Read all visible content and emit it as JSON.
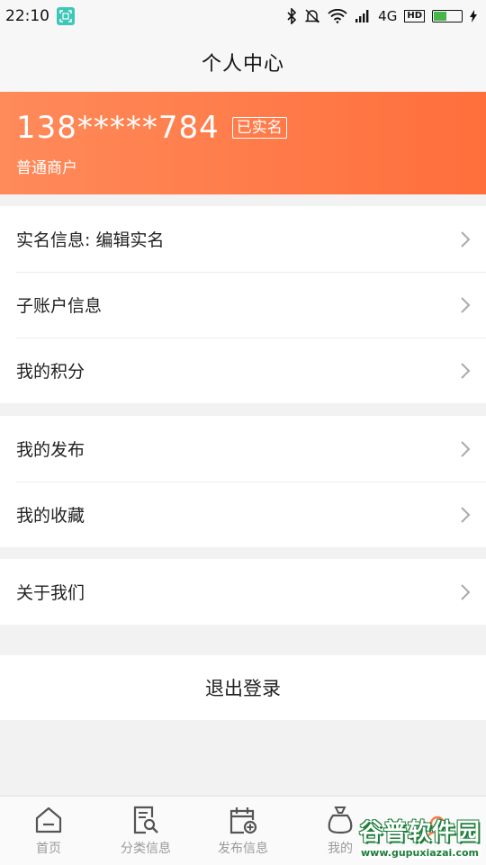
{
  "status_bar": {
    "time": "22:10",
    "network": "4G",
    "hd": "HD"
  },
  "header": {
    "title": "个人中心"
  },
  "profile": {
    "phone": "138*****784",
    "verified_tag": "已实名",
    "user_type": "普通商户",
    "accent_color": "#ff7a45"
  },
  "menu_groups": [
    {
      "items": [
        {
          "label": "实名信息: 编辑实名"
        },
        {
          "label": "子账户信息"
        },
        {
          "label": "我的积分"
        }
      ]
    },
    {
      "items": [
        {
          "label": "我的发布"
        },
        {
          "label": "我的收藏"
        }
      ]
    },
    {
      "items": [
        {
          "label": "关于我们"
        }
      ]
    }
  ],
  "logout": {
    "label": "退出登录"
  },
  "tabbar": {
    "tabs": [
      {
        "label": "首页",
        "icon": "home-icon"
      },
      {
        "label": "分类信息",
        "icon": "category-search-icon"
      },
      {
        "label": "发布信息",
        "icon": "publish-calendar-icon"
      },
      {
        "label": "我的",
        "icon": "wallet-icon"
      },
      {
        "label": "",
        "icon": "profile-icon"
      }
    ]
  },
  "watermark": {
    "title": "谷普软件园",
    "url": "www.gupuxiazai.com"
  }
}
